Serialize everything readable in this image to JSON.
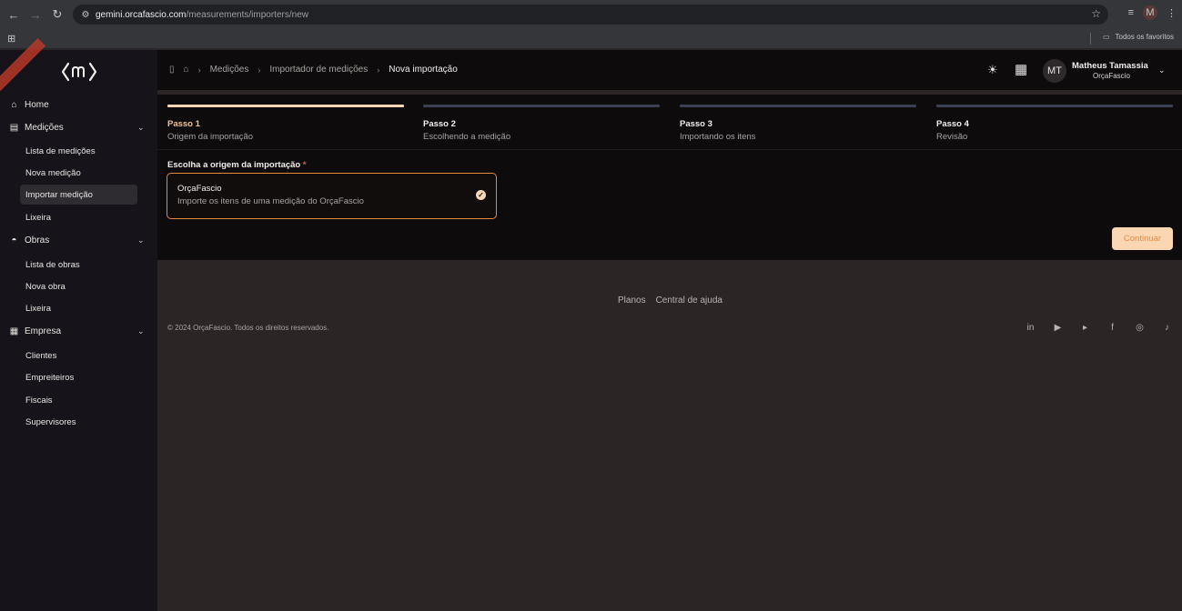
{
  "browser": {
    "url_host": "gemini.orcafascio.com",
    "url_path": "/measurements/importers/new",
    "profile_initial": "M",
    "bookmarks_folder": "Todos os favoritos"
  },
  "sidebar": {
    "ribbon": "",
    "sections": [
      {
        "label": "Home",
        "icon": "home-icon"
      },
      {
        "label": "Medições",
        "icon": "clipboard-icon",
        "items": [
          "Lista de medições",
          "Nova medição",
          "Importar medição",
          "Lixeira"
        ]
      },
      {
        "label": "Obras",
        "icon": "helmet-icon",
        "items": [
          "Lista de obras",
          "Nova obra",
          "Lixeira"
        ]
      },
      {
        "label": "Empresa",
        "icon": "building-icon",
        "items": [
          "Clientes",
          "Empreiteiros",
          "Fiscais",
          "Supervisores"
        ]
      }
    ],
    "active_item": "Importar medição"
  },
  "topbar": {
    "breadcrumbs": [
      "Medições",
      "Importador de medições",
      "Nova importação"
    ],
    "user": {
      "initials": "MT",
      "name": "Matheus Tamassia",
      "company": "OrçaFascio"
    }
  },
  "steps": [
    {
      "num": "Passo 1",
      "desc": "Origem da importação",
      "active": true
    },
    {
      "num": "Passo 2",
      "desc": "Escolhendo a medição",
      "active": false
    },
    {
      "num": "Passo 3",
      "desc": "Importando os itens",
      "active": false
    },
    {
      "num": "Passo 4",
      "desc": "Revisão",
      "active": false
    }
  ],
  "form": {
    "label": "Escolha a origem da importação",
    "required_mark": "*",
    "option": {
      "title": "OrçaFascio",
      "desc": "Importe os itens de uma medição do OrçaFascio",
      "selected": true
    },
    "continue_label": "Continuar"
  },
  "footer": {
    "links": [
      "Planos",
      "Central de ajuda"
    ],
    "copyright": "© 2024 OrçaFascio. Todos os direitos reservados.",
    "socials": [
      "linkedin-icon",
      "play-store-icon",
      "youtube-icon",
      "facebook-icon",
      "instagram-icon",
      "tiktok-icon"
    ]
  },
  "colors": {
    "accent": "#e9893a",
    "accent_light": "#fbd6b3",
    "step_active": "#f7d7b8",
    "step_inactive": "#3b4152"
  }
}
